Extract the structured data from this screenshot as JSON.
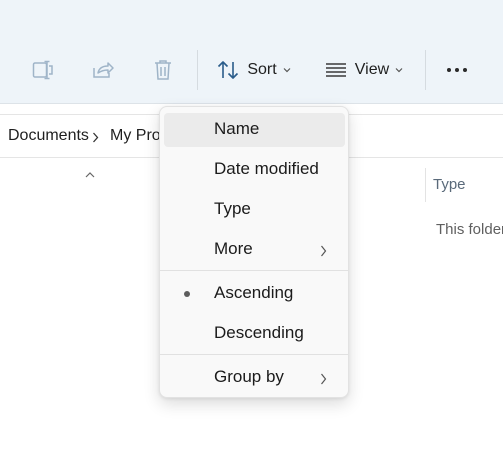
{
  "toolbar": {
    "sort_label": "Sort",
    "view_label": "View",
    "icons": [
      "rename-icon",
      "share-icon",
      "delete-icon",
      "sort-icon",
      "view-icon",
      "more-icon"
    ]
  },
  "breadcrumb": {
    "items": [
      "Documents",
      "My Proj"
    ]
  },
  "columns": {
    "type_label": "Type"
  },
  "content": {
    "empty_message": "This folder"
  },
  "sort_menu": {
    "items": [
      {
        "label": "Name",
        "highlighted": true
      },
      {
        "label": "Date modified"
      },
      {
        "label": "Type"
      },
      {
        "label": "More",
        "has_submenu": true
      },
      {
        "label": "Ascending",
        "selected": true
      },
      {
        "label": "Descending"
      },
      {
        "label": "Group by",
        "has_submenu": true
      }
    ]
  },
  "colors": {
    "toolbar_bg": "#eef4f9",
    "accent_icon": "#2a5c8a",
    "disabled_icon": "#9fb4c8",
    "menu_bg": "#f9f9f9",
    "menu_hover": "#ebebeb"
  }
}
